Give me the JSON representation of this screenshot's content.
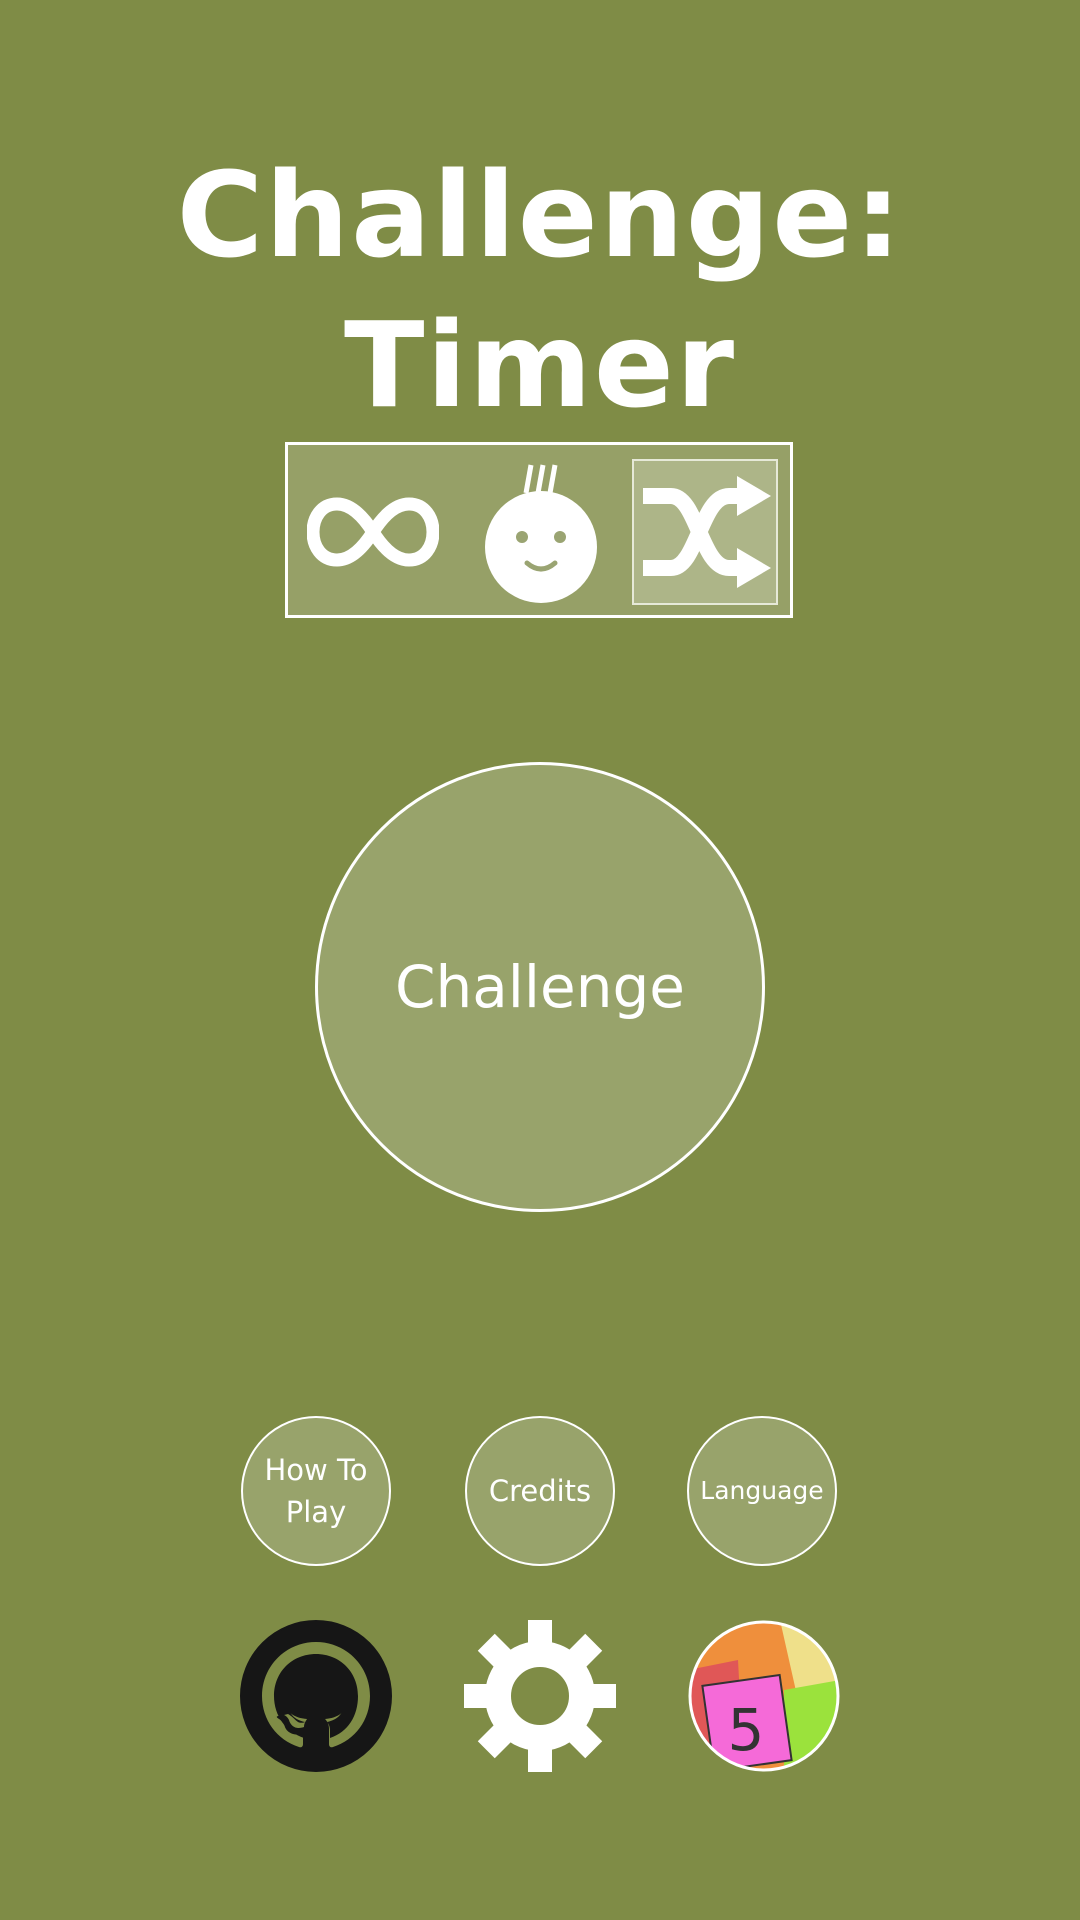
{
  "theme": {
    "background": "#7f8c46",
    "panel": "#9aa472",
    "text": "#ffffff"
  },
  "title": "Challenge: Timer",
  "modes": [
    {
      "icon": "infinity-icon",
      "selected": false
    },
    {
      "icon": "sweating-face-icon",
      "selected": false
    },
    {
      "icon": "shuffle-icon",
      "selected": true
    }
  ],
  "main_button": {
    "label": "Challenge"
  },
  "menu_buttons": {
    "how_to_play": "How To Play",
    "credits": "Credits",
    "language": "Language"
  },
  "bottom_icons": [
    "github-icon",
    "gear-icon",
    "app-logo-icon"
  ],
  "app_logo": {
    "number": "5"
  }
}
